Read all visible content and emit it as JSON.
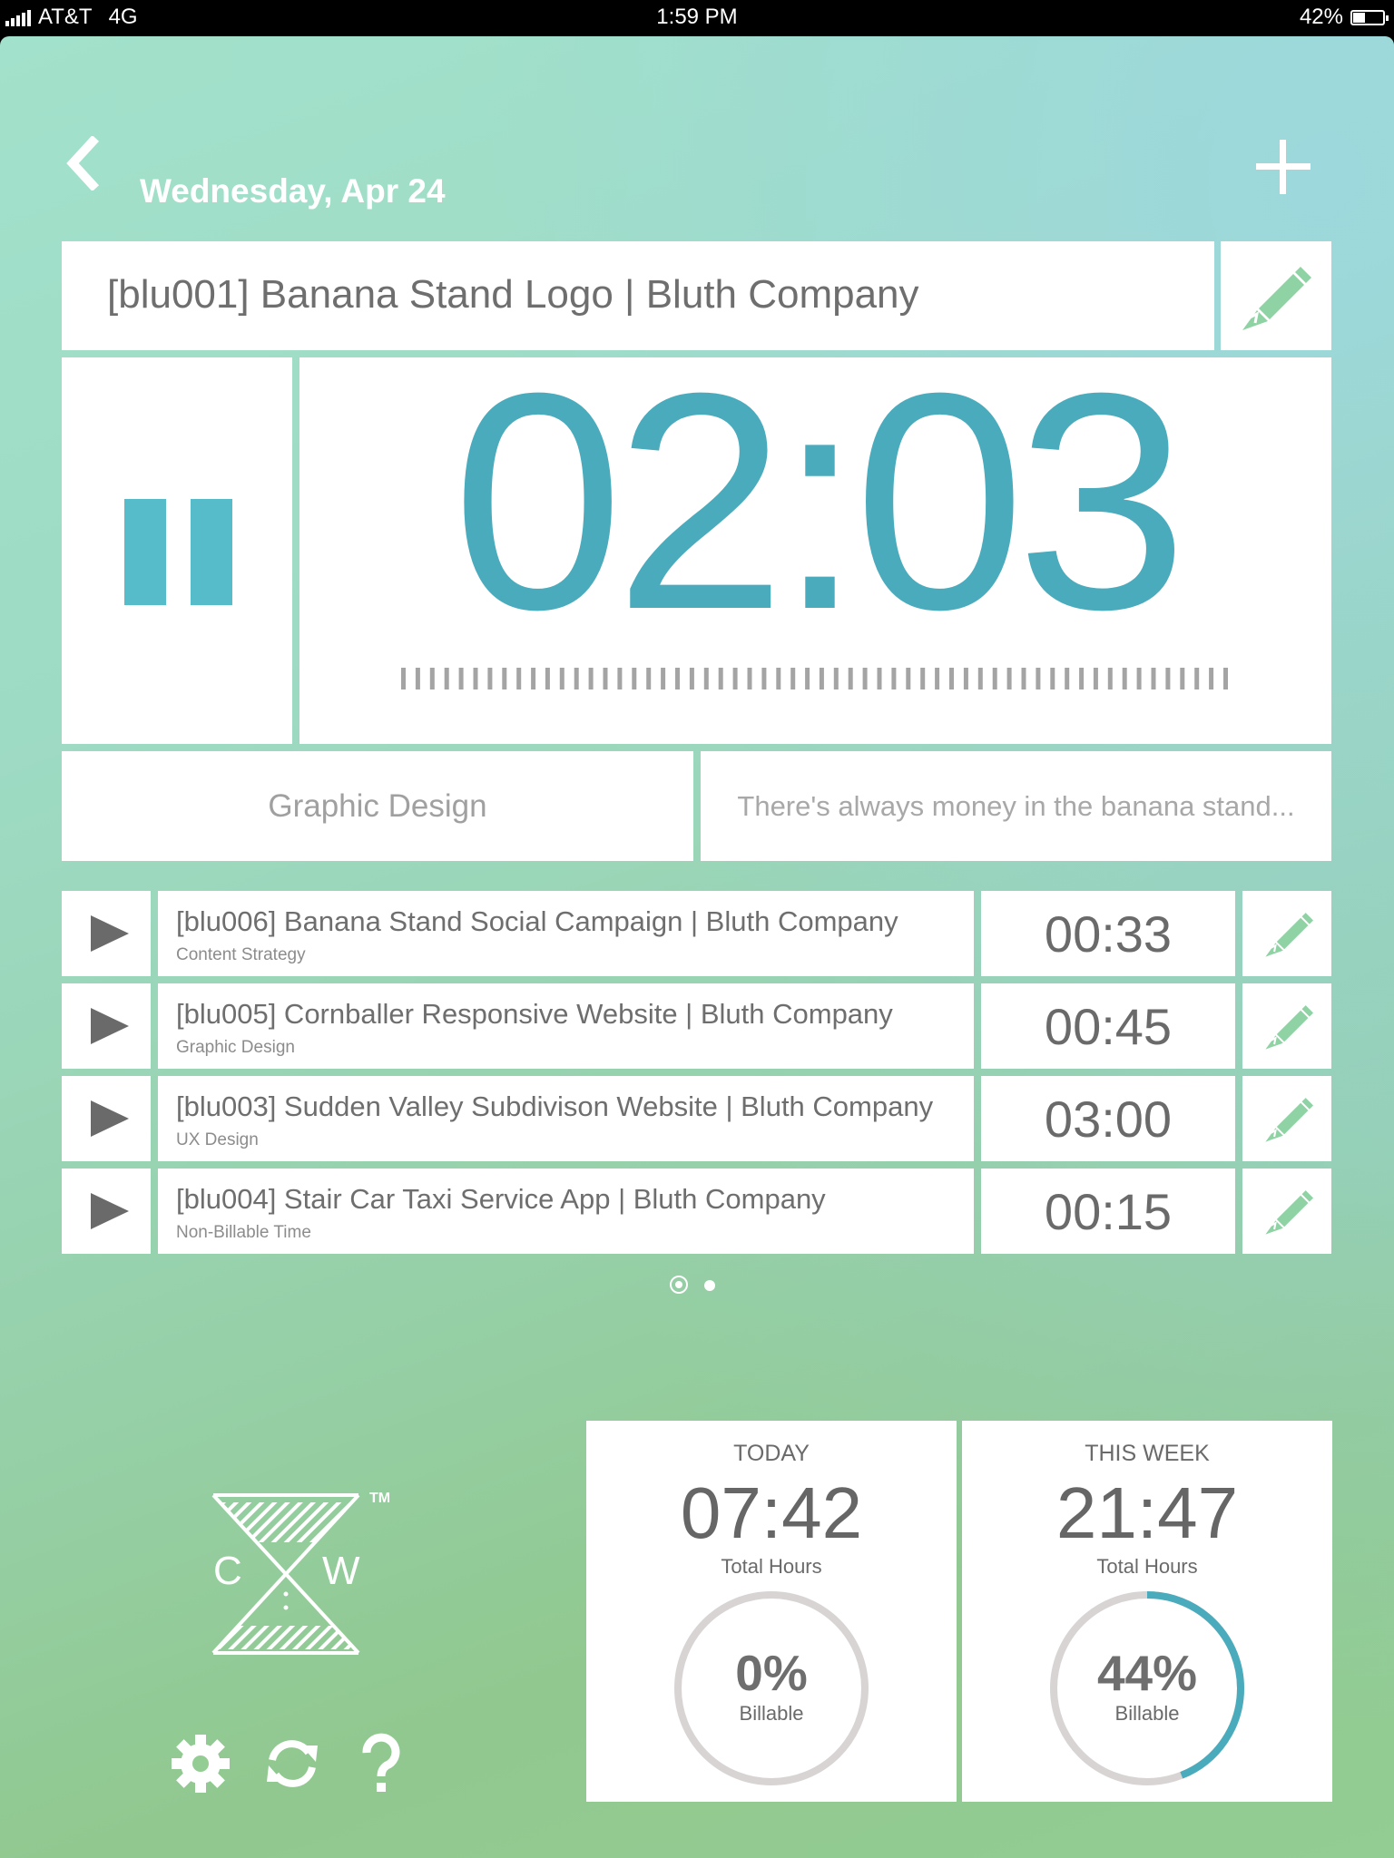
{
  "status_bar": {
    "carrier": "AT&T",
    "network": "4G",
    "time": "1:59 PM",
    "battery": "42%",
    "battery_level": 0.42
  },
  "header": {
    "date": "Wednesday, Apr 24"
  },
  "active_task": {
    "title": "[blu001] Banana Stand Logo | Bluth Company",
    "timer": "02:03",
    "category": "Graphic Design",
    "note": "There's always money in the banana stand..."
  },
  "tasks": [
    {
      "name": "[blu006] Banana Stand Social Campaign | Bluth Company",
      "category": "Content Strategy",
      "time": "00:33"
    },
    {
      "name": "[blu005] Cornballer Responsive Website | Bluth Company",
      "category": "Graphic Design",
      "time": "00:45"
    },
    {
      "name": "[blu003] Sudden Valley Subdivison Website | Bluth Company",
      "category": "UX Design",
      "time": "03:00"
    },
    {
      "name": "[blu004] Stair Car Taxi Service App | Bluth Company",
      "category": "Non-Billable Time",
      "time": "00:15"
    }
  ],
  "pager": {
    "pages": 2,
    "current": 1
  },
  "logo": {
    "letters": "C W",
    "tm": "TM"
  },
  "stats": {
    "today": {
      "label": "TODAY",
      "hours": "07:42",
      "sub": "Total Hours",
      "billable": "0%",
      "billable_label": "Billable",
      "billable_fraction": 0.0
    },
    "week": {
      "label": "THIS WEEK",
      "hours": "21:47",
      "sub": "Total Hours",
      "billable": "44%",
      "billable_label": "Billable",
      "billable_fraction": 0.44
    }
  },
  "footer_icons": [
    "gear-icon",
    "sync-icon",
    "help-icon"
  ],
  "colors": {
    "accent": "#4aabbc",
    "pause": "#56bcca",
    "edit_green": "#8fd3a5",
    "text_gray": "#6e6e6e",
    "ring_gray": "#d8d4d4"
  }
}
